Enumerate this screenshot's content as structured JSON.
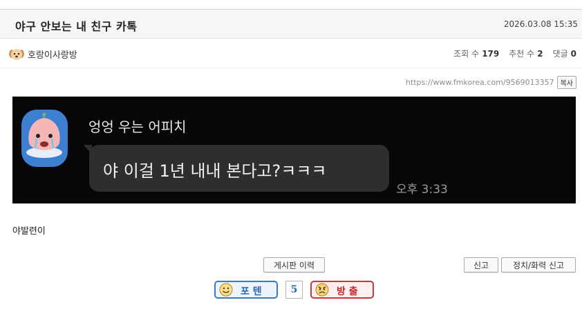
{
  "post": {
    "title": "야구 안보는 내 친구 카톡",
    "date": "2026.03.08 15:35",
    "author": "호랑이사랑방",
    "stats": {
      "views_label": "조회 수",
      "views": "179",
      "recommend_label": "추천 수",
      "recommend": "2",
      "comments_label": "댓글",
      "comments": "0"
    },
    "url": "https://www.fmkorea.com/9569013357",
    "copy_label": "복사",
    "body": "야발련이"
  },
  "chat": {
    "sender": "엉엉 우는 어피치",
    "message": "야 이걸 1년 내내 본다고?ㅋㅋㅋ",
    "time": "오후 3:33"
  },
  "actions": {
    "history_label": "게시판 이력",
    "report_label": "신고",
    "report2_label": "정치/화력 신고"
  },
  "votes": {
    "up_label": "포 텐",
    "count": "5",
    "down_label": "방 출"
  },
  "colors": {
    "chat_bg": "#070707",
    "bubble": "#2e2e2e",
    "vote_up": "#3b76c9",
    "vote_down": "#c83a3a"
  }
}
